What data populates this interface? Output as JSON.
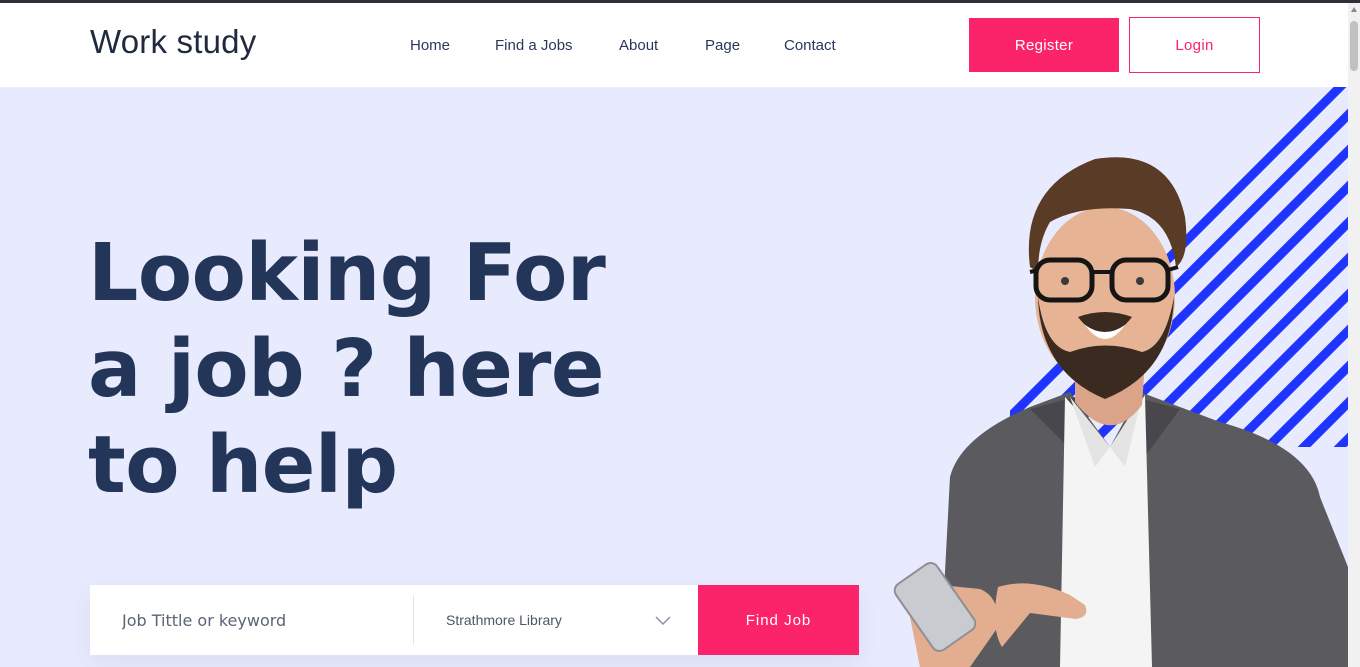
{
  "header": {
    "logo": "Work study",
    "nav": [
      "Home",
      "Find a Jobs",
      "About",
      "Page",
      "Contact"
    ],
    "register_label": "Register",
    "login_label": "Login"
  },
  "hero": {
    "headline_lines": [
      "Looking For",
      "a job ? here",
      "to help"
    ]
  },
  "search": {
    "keyword_placeholder": "Job Tittle or keyword",
    "location_selected": "Strathmore Library",
    "find_label": "Find Job"
  },
  "colors": {
    "accent": "#fb246a",
    "hero_bg": "#e8ebfd",
    "headline": "#24355a",
    "stripes": "#1f35ff"
  }
}
